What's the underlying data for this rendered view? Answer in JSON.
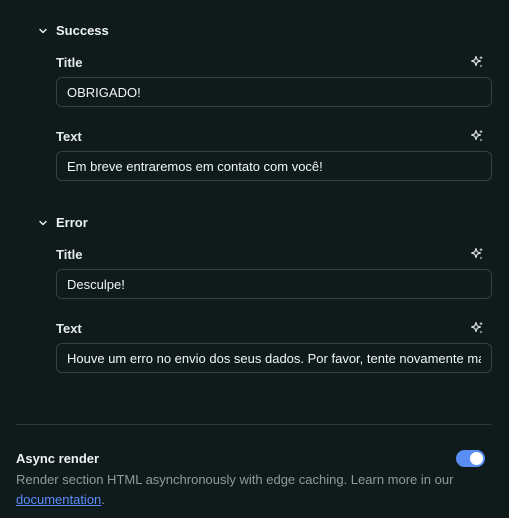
{
  "success": {
    "header": "Success",
    "title_label": "Title",
    "title_value": "OBRIGADO!",
    "text_label": "Text",
    "text_value": "Em breve entraremos em contato com você!"
  },
  "error": {
    "header": "Error",
    "title_label": "Title",
    "title_value": "Desculpe!",
    "text_label": "Text",
    "text_value": "Houve um erro no envio dos seus dados. Por favor, tente novamente mais tarde."
  },
  "async_render": {
    "title": "Async render",
    "description": "Render section HTML asynchronously with edge caching. Learn more in our",
    "link_text": "documentation",
    "suffix": ".",
    "enabled": true
  },
  "icons": {
    "section_toggle": "chevron-down-icon",
    "ai_generate": "sparkles-icon"
  },
  "colors": {
    "background": "#0f1a1a",
    "toggle_on": "#5b8ef5",
    "link": "#5b8cff"
  }
}
